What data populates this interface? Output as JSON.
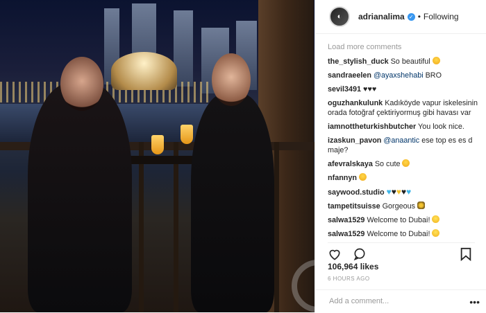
{
  "post": {
    "username": "adrianalima",
    "follow_status": "Following",
    "separator": "•",
    "load_more": "Load more comments",
    "likes": "106,964 likes",
    "time_ago": "6 HOURS AGO",
    "add_comment_placeholder": "Add a comment...",
    "more_options": "•••"
  },
  "comments": [
    {
      "user": "the_stylish_duck",
      "text": "So beautiful",
      "emoji": "heart-eyes"
    },
    {
      "user": "sandraeelen",
      "mention": "@ayaxshehabi",
      "text": "BRO"
    },
    {
      "user": "sevil3491",
      "text": "♥♥♥"
    },
    {
      "user": "oguzhankulunk",
      "text": "Kadıköyde vapur iskelesinin orada fotoğraf çektiriyormuş gibi havası var"
    },
    {
      "user": "iamnottheturkishbutcher",
      "text": "You look nice."
    },
    {
      "user": "izaskun_pavon",
      "mention": "@anaantic",
      "text": "ese top es es d maje?"
    },
    {
      "user": "afevralskaya",
      "text": "So cute",
      "emoji": "heart-eyes"
    },
    {
      "user": "nfannyn",
      "text": "",
      "emoji": "heart-eyes"
    },
    {
      "user": "saywood.studio",
      "text": "",
      "hearts": [
        "#3fb6e8",
        "#222",
        "#f2c230",
        "#222",
        "#3fb6e8"
      ]
    },
    {
      "user": "tampetitsuisse",
      "text": "Gorgeous",
      "emoji": "sparkle"
    },
    {
      "user": "salwa1529",
      "text": "Welcome to Dubai!",
      "emoji": "smile"
    },
    {
      "user": "salwa1529",
      "text": "Welcome to Dubai!",
      "emoji": "smile"
    }
  ],
  "colors": {
    "accent": "#3897f0",
    "text": "#262626",
    "muted": "#999999",
    "link": "#003569"
  }
}
